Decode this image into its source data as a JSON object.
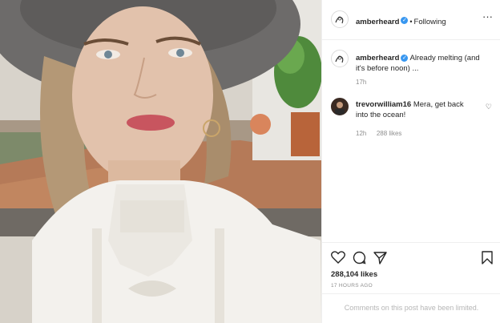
{
  "post": {
    "author": "amberheard",
    "follow_status": "Following",
    "caption_author": "amberheard",
    "caption_text": "Already melting (and it's before noon) ...",
    "caption_time": "17h"
  },
  "comments": [
    {
      "username": "trevorwilliam16",
      "text": "Mera, get back into the ocean!",
      "time": "12h",
      "likes": "288 likes"
    }
  ],
  "engagement": {
    "likes": "288,104 likes",
    "posted": "17 HOURS AGO"
  },
  "footer": {
    "notice": "Comments on this post have been limited."
  },
  "icons": {
    "verified": "verified-badge-icon",
    "more": "more-options-icon",
    "like": "heart-icon",
    "comment": "comment-icon",
    "share": "share-icon",
    "save": "bookmark-icon"
  },
  "colors": {
    "verified": "#3897f0",
    "text": "#262626",
    "muted": "#8e8e8e",
    "border": "#efefef"
  }
}
